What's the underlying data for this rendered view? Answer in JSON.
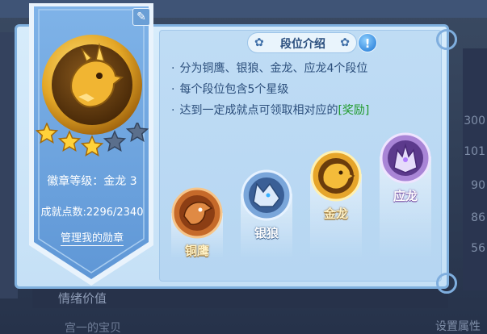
{
  "background": {
    "side_numbers": [
      "300",
      "101",
      "90",
      "86",
      "56"
    ],
    "bottom_label": "情绪价值",
    "bottom_label_2": "宫一的宝贝",
    "bottom_right": "设置属性"
  },
  "badge": {
    "level_text": "徽章等级：金龙 3",
    "points_text": "成就点数:2296/2340",
    "manage_label": "管理我的勋章",
    "stars_filled": 3,
    "stars_total": 5
  },
  "intro": {
    "title": "段位介绍",
    "info_symbol": "!",
    "rules": [
      {
        "text": "分为铜鹰、银狼、金龙、应龙4个段位"
      },
      {
        "text": "每个段位包含5个星级"
      },
      {
        "text": "达到一定成就点可领取相对应的",
        "reward": "[奖励]"
      }
    ]
  },
  "tiers": [
    {
      "name": "铜鹰",
      "icon": "bronze-eagle-icon"
    },
    {
      "name": "银狼",
      "icon": "silver-wolf-icon"
    },
    {
      "name": "金龙",
      "icon": "gold-dragon-icon"
    },
    {
      "name": "应龙",
      "icon": "purple-dragon-icon"
    }
  ],
  "colors": {
    "reward_text": "#1f9a2a",
    "panel_blue": "#bfdcf4",
    "gold": "#e0a020"
  }
}
